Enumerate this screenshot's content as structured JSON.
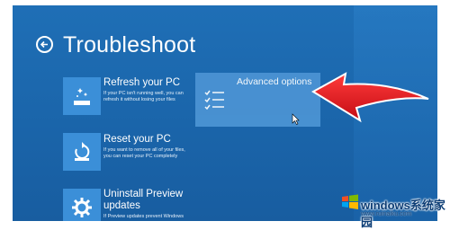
{
  "header": {
    "title": "Troubleshoot"
  },
  "options": [
    {
      "title": "Refresh your PC",
      "desc_lines": [
        "If your PC isn't running well, you can",
        "refresh it without losing your files"
      ]
    },
    {
      "title": "Reset your PC",
      "desc_lines": [
        "If you want to remove all of your files,",
        "you can reset your PC completely"
      ]
    },
    {
      "title_lines": [
        "Uninstall Preview",
        "updates"
      ],
      "desc_lines": [
        "If Preview updates prevent Windows"
      ]
    }
  ],
  "advanced": {
    "label": "Advanced options"
  },
  "watermark": {
    "text": "windows系统家园",
    "sub": "www.ruinaiku.com"
  },
  "colors": {
    "screen_bg": "#1a64a9",
    "tile": "#3b8fd8",
    "arrow": "#e0141c"
  }
}
